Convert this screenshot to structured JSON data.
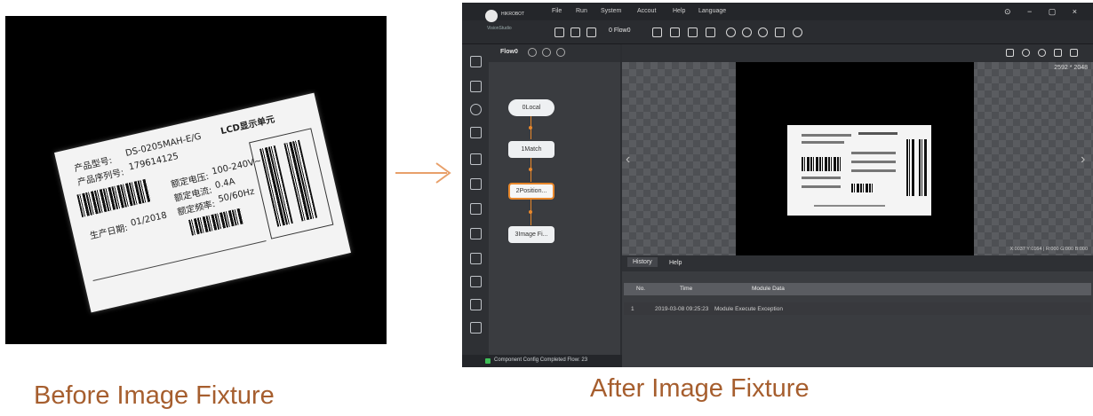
{
  "captions": {
    "before": "Before Image Fixture",
    "after": "After Image Fixture"
  },
  "before_image": {
    "label_texts": [
      "产品型号:",
      "DS-0205MAH-E/G",
      "产品序列号:",
      "179614125",
      "LCD显示单元",
      "额定电压:",
      "100-240V~",
      "额定电流:",
      "0.4A",
      "生产日期:",
      "01/2018",
      "额定频率:",
      "50/60Hz"
    ]
  },
  "app": {
    "brand": "HIKROBOT",
    "brand_sub": "VisionStudio",
    "menu": [
      "File",
      "Run",
      "System",
      "Accout",
      "Help",
      "Language"
    ],
    "window_controls": "⊙ − ▢ ×",
    "toolbar_flow": "0 Flow0",
    "flow_tab": "Flow0",
    "nodes": [
      "0Local",
      "1Match",
      "2Position...",
      "3Image Fi..."
    ],
    "resolution": "2592 * 2048",
    "coords": "X:0037 Y:0164 | R:000 G:000 B:000",
    "bottom_tabs": [
      "History",
      "Help"
    ],
    "table": {
      "headers": [
        "No.",
        "Time",
        "Module Data"
      ],
      "rows": [
        [
          "1",
          "2019-03-08 09:25:23",
          "Module Execute Exception"
        ]
      ]
    },
    "status": "Component Config Completed  Flow: 23"
  },
  "colors": {
    "caption": "#a65e2e",
    "accent": "#e8872b",
    "status_ok": "#3fbf57"
  }
}
